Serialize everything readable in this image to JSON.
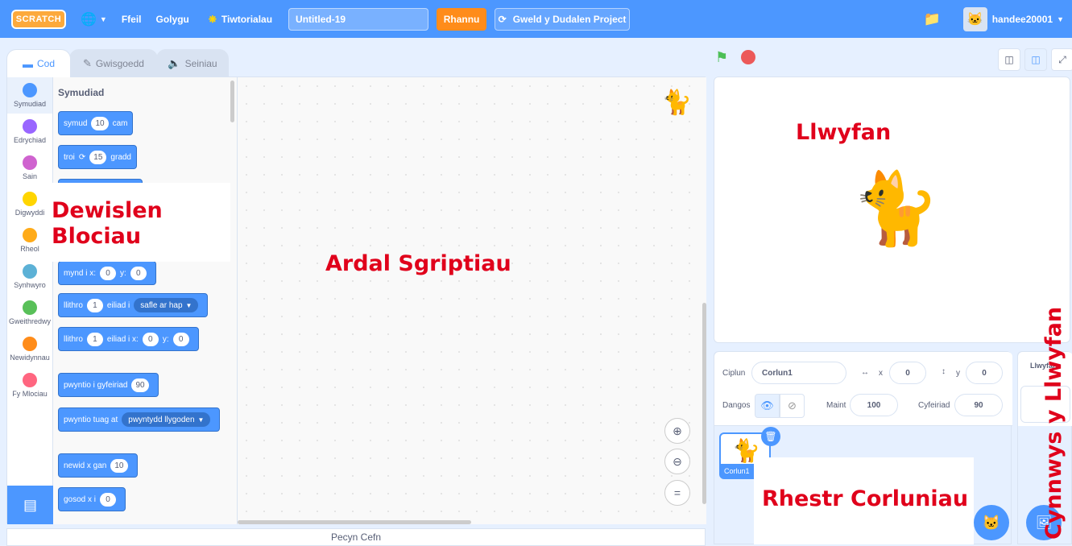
{
  "menubar": {
    "logo": "SCRATCH",
    "language_icon": "globe-icon",
    "file_label": "Ffeil",
    "edit_label": "Golygu",
    "tutorials_label": "Tiwtorialau",
    "project_title": "Untitled-19",
    "share_label": "Rhannu",
    "see_project_label": "Gweld y Dudalen Project",
    "username": "handee20001"
  },
  "tabs": [
    {
      "label": "Cod",
      "icon": "code-icon"
    },
    {
      "label": "Gwisgoedd",
      "icon": "brush-icon"
    },
    {
      "label": "Seiniau",
      "icon": "speaker-icon"
    }
  ],
  "categories": [
    {
      "label": "Symudiad",
      "color": "#4c97ff"
    },
    {
      "label": "Edrychiad",
      "color": "#9966ff"
    },
    {
      "label": "Sain",
      "color": "#cf63cf"
    },
    {
      "label": "Digwyddi",
      "color": "#ffd500"
    },
    {
      "label": "Rheol",
      "color": "#ffab19"
    },
    {
      "label": "Synhwyro",
      "color": "#5cb1d6"
    },
    {
      "label": "Gweithredwy",
      "color": "#59c059"
    },
    {
      "label": "Newidynnau",
      "color": "#ff8c1a"
    },
    {
      "label": "Fy Mlociau",
      "color": "#ff6680"
    }
  ],
  "palette": {
    "heading": "Symudiad",
    "blocks": {
      "move": {
        "pre": "symud",
        "num": "10",
        "post": "cam"
      },
      "turn": {
        "pre": "troi",
        "num": "15",
        "post": "gradd"
      },
      "goto_xy": {
        "pre": "mynd i x:",
        "x": "0",
        "ylabel": "y:",
        "y": "0"
      },
      "glide_to": {
        "pre": "llithro",
        "num": "1",
        "mid": "eiliad i",
        "dropdown": "safle ar hap"
      },
      "glide_xy": {
        "pre": "llithro",
        "num": "1",
        "mid": "eiliad i x:",
        "x": "0",
        "ylabel": "y:",
        "y": "0"
      },
      "point_dir": {
        "pre": "pwyntio i gyfeiriad",
        "num": "90"
      },
      "point_towards": {
        "pre": "pwyntio tuag at",
        "dropdown": "pwyntydd llygoden"
      },
      "change_x": {
        "pre": "newid x gan",
        "num": "10"
      },
      "set_x": {
        "pre": "gosod x i",
        "num": "0"
      }
    }
  },
  "backpack_label": "Pecyn Cefn",
  "sprite_info": {
    "sprite_label": "Ciplun",
    "sprite_name": "Corlun1",
    "x_label": "x",
    "x_value": "0",
    "y_label": "y",
    "y_value": "0",
    "show_label": "Dangos",
    "size_label": "Maint",
    "size_value": "100",
    "direction_label": "Cyfeiriad",
    "direction_value": "90",
    "sprite_tile_name": "Corlun1"
  },
  "stage_pane": {
    "label": "Llwyfan"
  },
  "annotations": {
    "blocks_menu": [
      "Dewislen",
      "Blociau"
    ],
    "script_area": "Ardal Sgriptiau",
    "stage": "Llwyfan",
    "sprite_list": "Rhestr Corluniau",
    "stage_backdrops": "Cynnwys y Llwyfan"
  }
}
